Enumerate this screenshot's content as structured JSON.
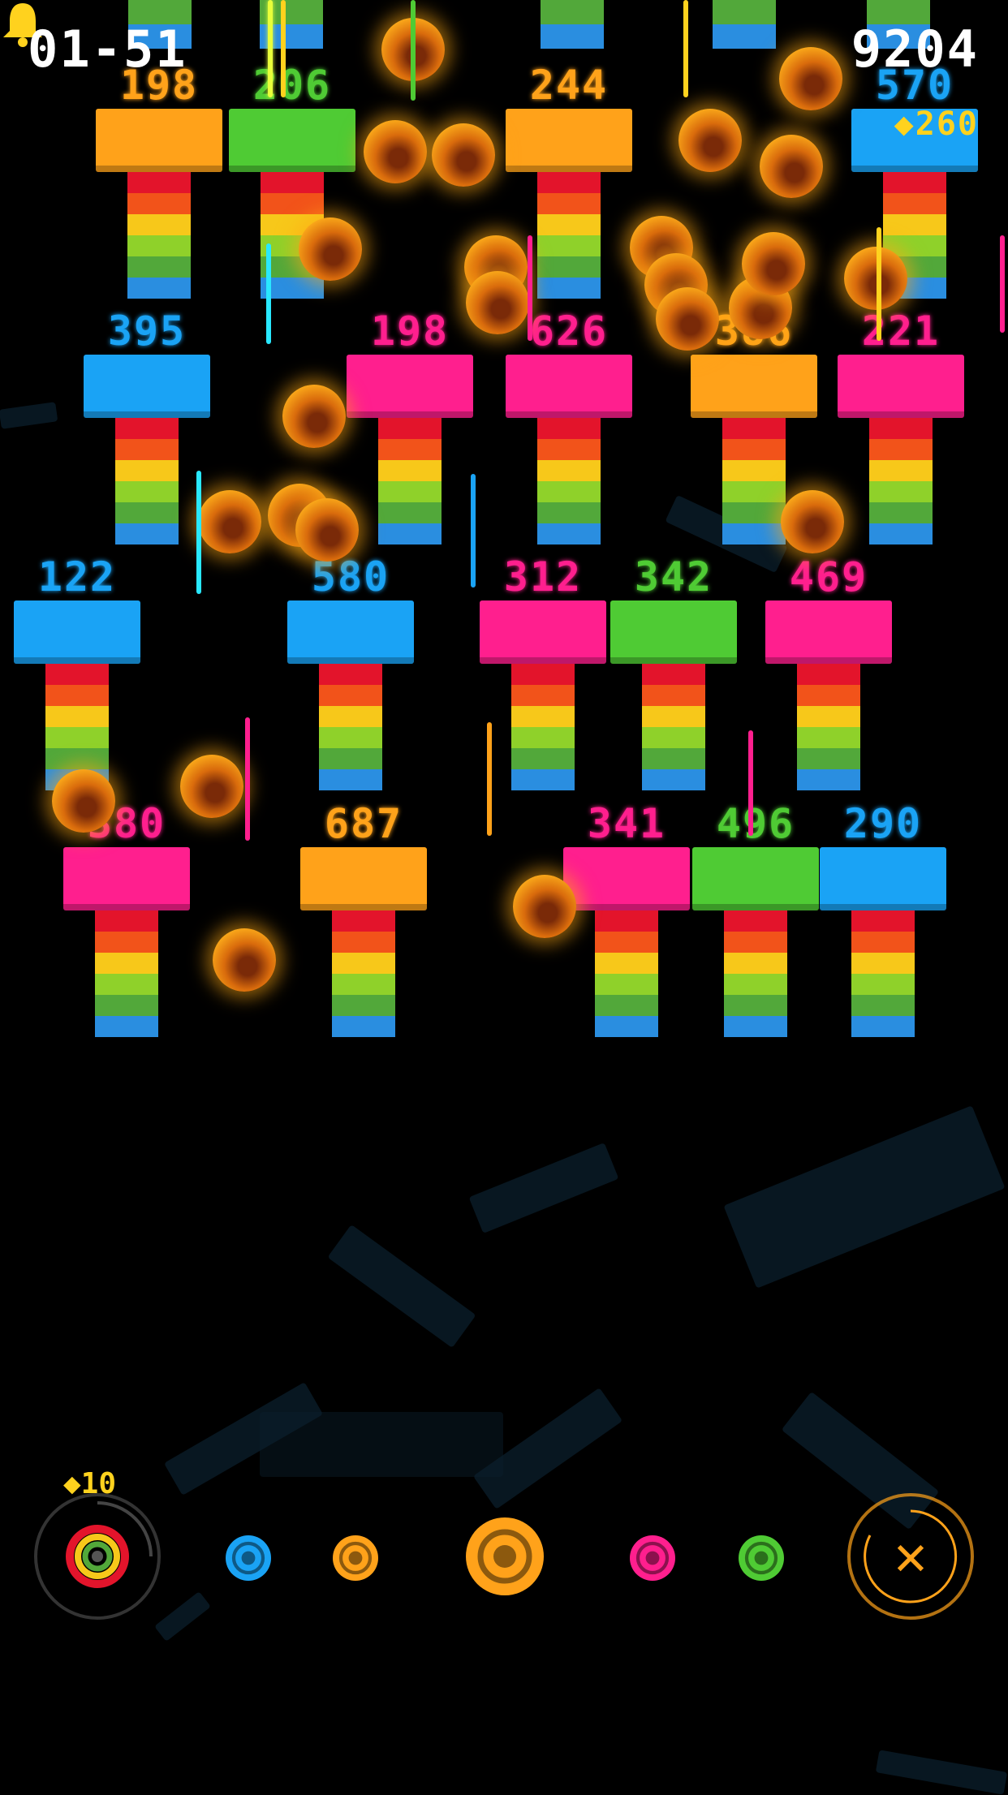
{
  "hud": {
    "level": "01-51",
    "score": "9204",
    "gems": "◆260",
    "bell_icon": "bell-icon"
  },
  "colors": {
    "orange": "#ffa21a",
    "green": "#4fcb34",
    "blue": "#1aa3f5",
    "pink": "#ff1f8e",
    "yellow": "#ffd21e",
    "ball": "#ffb21c"
  },
  "blocks": [
    {
      "value": "198",
      "color": "orange"
    },
    {
      "value": "206",
      "color": "green"
    },
    {
      "value": "244",
      "color": "orange"
    },
    {
      "value": "570",
      "color": "blue"
    },
    {
      "value": "395",
      "color": "blue"
    },
    {
      "value": "198",
      "color": "pink"
    },
    {
      "value": "626",
      "color": "pink"
    },
    {
      "value": "386",
      "color": "orange"
    },
    {
      "value": "221",
      "color": "pink"
    },
    {
      "value": "122",
      "color": "blue"
    },
    {
      "value": "580",
      "color": "blue"
    },
    {
      "value": "312",
      "color": "pink"
    },
    {
      "value": "342",
      "color": "green"
    },
    {
      "value": "469",
      "color": "pink"
    },
    {
      "value": "380",
      "color": "pink"
    },
    {
      "value": "687",
      "color": "orange"
    },
    {
      "value": "341",
      "color": "pink"
    },
    {
      "value": "496",
      "color": "green"
    },
    {
      "value": "290",
      "color": "blue"
    }
  ],
  "bottom_bar": {
    "cost": "◆10",
    "rainbow_shooter": "rainbow-target-icon",
    "color_buttons": [
      "blue",
      "orange",
      "orange",
      "pink",
      "green"
    ],
    "close_label": "✕"
  }
}
